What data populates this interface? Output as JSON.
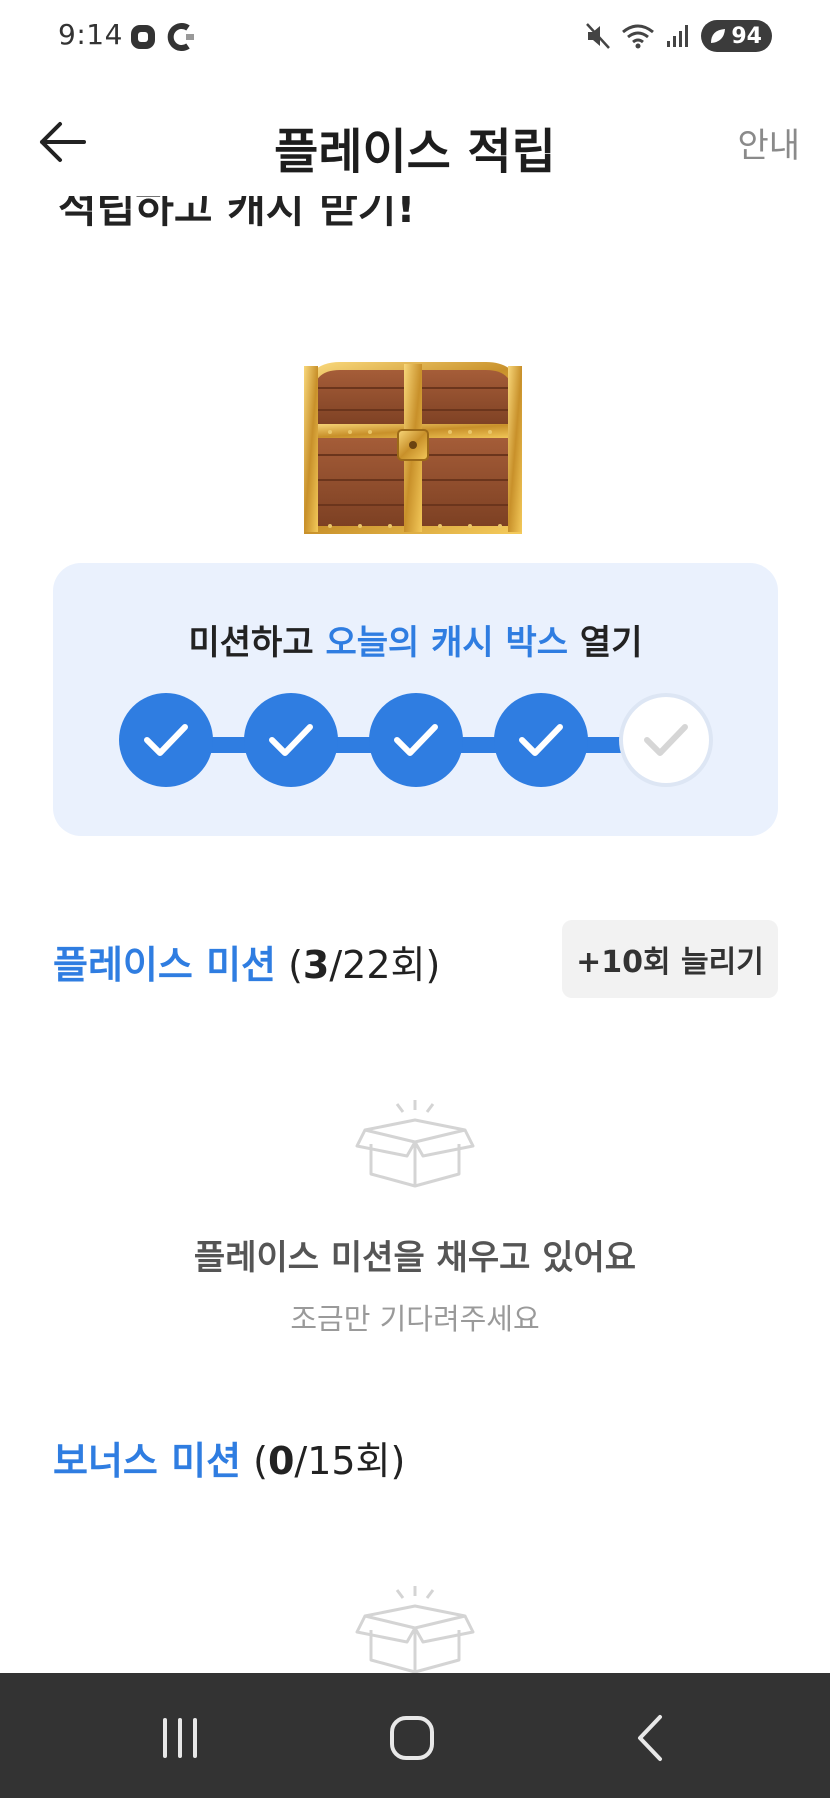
{
  "status_bar": {
    "time": "9:14",
    "battery": "94",
    "icons": [
      "notification-app-icon",
      "cast-app-icon",
      "mute-icon",
      "wifi-icon",
      "signal-icon",
      "battery-icon"
    ]
  },
  "header": {
    "title": "플레이스 적립",
    "right_link": "안내",
    "back_icon": "arrow-left-icon"
  },
  "hidden_top_text": "적립하고 캐시 받기!",
  "mission_card": {
    "title_prefix": "미션하고 ",
    "title_accent": "오늘의 캐시 박스",
    "title_suffix": " 열기",
    "steps": [
      true,
      true,
      true,
      true,
      false
    ]
  },
  "place_mission": {
    "title": "플레이스 미션",
    "count_open": " (",
    "count_done": "3",
    "count_total": "/22회)",
    "increase_button": "+10회 늘리기",
    "empty_title": "플레이스 미션을 채우고 있어요",
    "empty_subtitle": "조금만 기다려주세요"
  },
  "bonus_mission": {
    "title": "보너스 미션",
    "count_open": " (",
    "count_done": "0",
    "count_total": "/15회)"
  },
  "colors": {
    "accent": "#2f7de1",
    "card_bg": "#eaf1fd",
    "nav_bg": "#333333"
  }
}
